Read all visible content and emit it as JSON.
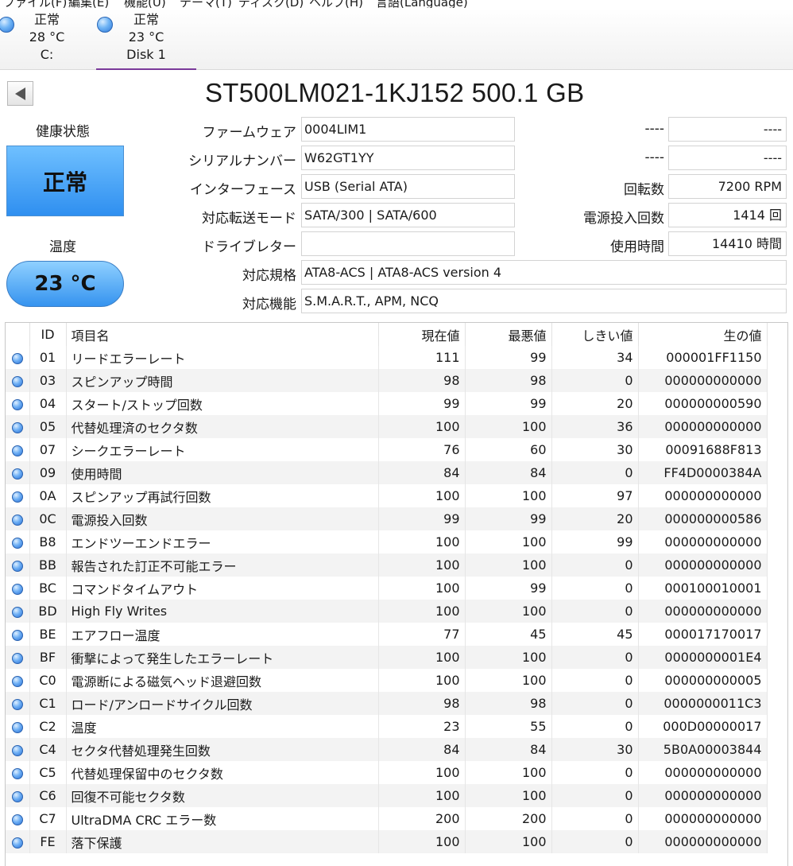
{
  "menu": [
    "ファイル(F)",
    "編集(E)",
    "機能(U)",
    "テーマ(T)",
    "ディスク(D)",
    "ヘルプ(H)",
    "言語(Language)"
  ],
  "disks": [
    {
      "status": "正常",
      "temp": "28 °C",
      "label": "C:",
      "selected": false
    },
    {
      "status": "正常",
      "temp": "23 °C",
      "label": "Disk 1",
      "selected": true
    }
  ],
  "header": {
    "title": "ST500LM021-1KJ152 500.1 GB"
  },
  "health": {
    "label": "健康状態",
    "value": "正常",
    "color": "#3a96f2"
  },
  "temperature": {
    "label": "温度",
    "value": "23 °C"
  },
  "info": {
    "firmware": {
      "label": "ファームウェア",
      "value": "0004LIM1"
    },
    "serial": {
      "label": "シリアルナンバー",
      "value": "W62GT1YY"
    },
    "interface": {
      "label": "インターフェース",
      "value": "USB (Serial ATA)"
    },
    "transfer_mode": {
      "label": "対応転送モード",
      "value": "SATA/300 | SATA/600"
    },
    "drive_letter": {
      "label": "ドライブレター",
      "value": ""
    },
    "standard": {
      "label": "対応規格",
      "value": "ATA8-ACS | ATA8-ACS version 4"
    },
    "features": {
      "label": "対応機能",
      "value": "S.M.A.R.T., APM, NCQ"
    },
    "blank1": {
      "label": "----",
      "value": "----"
    },
    "blank2": {
      "label": "----",
      "value": "----"
    },
    "rotation": {
      "label": "回転数",
      "value": "7200 RPM"
    },
    "power_on_count": {
      "label": "電源投入回数",
      "value": "1414 回"
    },
    "power_on_hours": {
      "label": "使用時間",
      "value": "14410 時間"
    }
  },
  "smart": {
    "headers": {
      "id": "ID",
      "name": "項目名",
      "current": "現在値",
      "worst": "最悪値",
      "threshold": "しきい値",
      "raw": "生の値"
    },
    "rows": [
      {
        "id": "01",
        "name": "リードエラーレート",
        "current": "111",
        "worst": "99",
        "threshold": "34",
        "raw": "000001FF1150"
      },
      {
        "id": "03",
        "name": "スピンアップ時間",
        "current": "98",
        "worst": "98",
        "threshold": "0",
        "raw": "000000000000"
      },
      {
        "id": "04",
        "name": "スタート/ストップ回数",
        "current": "99",
        "worst": "99",
        "threshold": "20",
        "raw": "000000000590"
      },
      {
        "id": "05",
        "name": "代替処理済のセクタ数",
        "current": "100",
        "worst": "100",
        "threshold": "36",
        "raw": "000000000000"
      },
      {
        "id": "07",
        "name": "シークエラーレート",
        "current": "76",
        "worst": "60",
        "threshold": "30",
        "raw": "00091688F813"
      },
      {
        "id": "09",
        "name": "使用時間",
        "current": "84",
        "worst": "84",
        "threshold": "0",
        "raw": "FF4D0000384A"
      },
      {
        "id": "0A",
        "name": "スピンアップ再試行回数",
        "current": "100",
        "worst": "100",
        "threshold": "97",
        "raw": "000000000000"
      },
      {
        "id": "0C",
        "name": "電源投入回数",
        "current": "99",
        "worst": "99",
        "threshold": "20",
        "raw": "000000000586"
      },
      {
        "id": "B8",
        "name": "エンドツーエンドエラー",
        "current": "100",
        "worst": "100",
        "threshold": "99",
        "raw": "000000000000"
      },
      {
        "id": "BB",
        "name": "報告された訂正不可能エラー",
        "current": "100",
        "worst": "100",
        "threshold": "0",
        "raw": "000000000000"
      },
      {
        "id": "BC",
        "name": "コマンドタイムアウト",
        "current": "100",
        "worst": "99",
        "threshold": "0",
        "raw": "000100010001"
      },
      {
        "id": "BD",
        "name": "High Fly Writes",
        "current": "100",
        "worst": "100",
        "threshold": "0",
        "raw": "000000000000"
      },
      {
        "id": "BE",
        "name": "エアフロー温度",
        "current": "77",
        "worst": "45",
        "threshold": "45",
        "raw": "000017170017"
      },
      {
        "id": "BF",
        "name": "衝撃によって発生したエラーレート",
        "current": "100",
        "worst": "100",
        "threshold": "0",
        "raw": "0000000001E4"
      },
      {
        "id": "C0",
        "name": "電源断による磁気ヘッド退避回数",
        "current": "100",
        "worst": "100",
        "threshold": "0",
        "raw": "000000000005"
      },
      {
        "id": "C1",
        "name": "ロード/アンロードサイクル回数",
        "current": "98",
        "worst": "98",
        "threshold": "0",
        "raw": "0000000011C3"
      },
      {
        "id": "C2",
        "name": "温度",
        "current": "23",
        "worst": "55",
        "threshold": "0",
        "raw": "000D00000017"
      },
      {
        "id": "C4",
        "name": "セクタ代替処理発生回数",
        "current": "84",
        "worst": "84",
        "threshold": "30",
        "raw": "5B0A00003844"
      },
      {
        "id": "C5",
        "name": "代替処理保留中のセクタ数",
        "current": "100",
        "worst": "100",
        "threshold": "0",
        "raw": "000000000000"
      },
      {
        "id": "C6",
        "name": "回復不可能セクタ数",
        "current": "100",
        "worst": "100",
        "threshold": "0",
        "raw": "000000000000"
      },
      {
        "id": "C7",
        "name": "UltraDMA CRC エラー数",
        "current": "200",
        "worst": "200",
        "threshold": "0",
        "raw": "000000000000"
      },
      {
        "id": "FE",
        "name": "落下保護",
        "current": "100",
        "worst": "100",
        "threshold": "0",
        "raw": "000000000000"
      }
    ]
  }
}
